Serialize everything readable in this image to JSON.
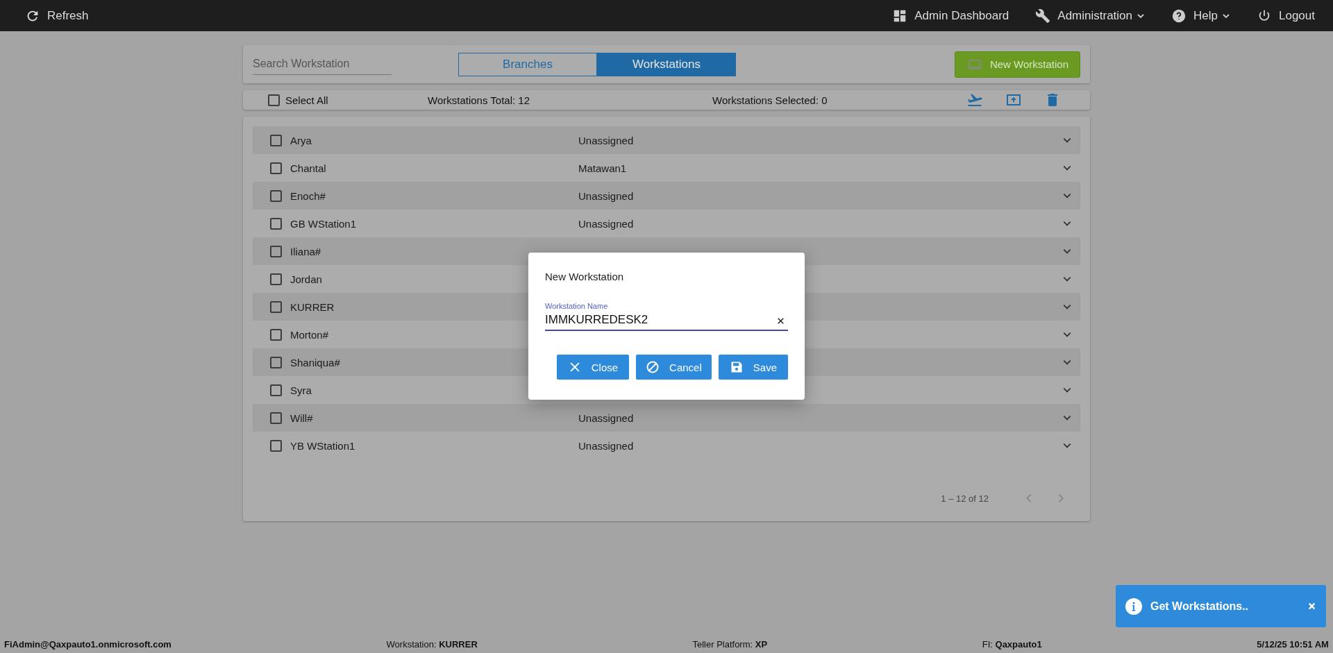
{
  "topbar": {
    "refresh": "Refresh",
    "links": [
      {
        "kind": "dashboard",
        "label": "Admin Dashboard",
        "dropdown": false
      },
      {
        "kind": "wrench",
        "label": "Administration",
        "dropdown": true
      },
      {
        "kind": "help",
        "label": "Help",
        "dropdown": true
      },
      {
        "kind": "power",
        "label": "Logout",
        "dropdown": false
      }
    ]
  },
  "search": {
    "placeholder": "Search Workstation"
  },
  "tabs": [
    {
      "label": "Branches",
      "selected": false
    },
    {
      "label": "Workstations",
      "selected": true
    }
  ],
  "new_button": "New Workstation",
  "toolbar": {
    "select_all": {
      "label": "Select All",
      "checked": false
    },
    "total": "Workstations Total: 12",
    "selected": "Workstations Selected: 0",
    "actions": [
      {
        "kind": "move"
      },
      {
        "kind": "upload"
      },
      {
        "kind": "delete"
      }
    ]
  },
  "rows": [
    {
      "name": "Arya",
      "location": "Unassigned",
      "checked": false
    },
    {
      "name": "Chantal",
      "location": "Matawan1",
      "checked": false
    },
    {
      "name": "Enoch#",
      "location": "Unassigned",
      "checked": false
    },
    {
      "name": "GB WStation1",
      "location": "Unassigned",
      "checked": false
    },
    {
      "name": "Iliana#",
      "checked": false
    },
    {
      "name": "Jordan",
      "checked": false
    },
    {
      "name": "KURRER",
      "checked": false
    },
    {
      "name": "Morton#",
      "checked": false
    },
    {
      "name": "Shaniqua#",
      "checked": false
    },
    {
      "name": "Syra",
      "checked": false
    },
    {
      "name": "Will#",
      "location": "Unassigned",
      "checked": false
    },
    {
      "name": "YB WStation1",
      "location": "Unassigned",
      "checked": false
    }
  ],
  "pagination": {
    "range": "1 – 12 of 12"
  },
  "dialog": {
    "title": "New Workstation",
    "field": {
      "label": "Workstation Name",
      "value": "IMMKURREDESK2"
    },
    "buttons": [
      {
        "kind": "close",
        "label": "Close"
      },
      {
        "kind": "cancel",
        "label": "Cancel"
      },
      {
        "kind": "save",
        "label": "Save"
      }
    ]
  },
  "status_bar": [
    {
      "value": "FiAdmin@Qaxpauto1.onmicrosoft.com"
    },
    {
      "label": "Workstation: ",
      "value": "KURRER"
    },
    {
      "label": "Teller Platform: ",
      "value": "XP"
    },
    {
      "label": "FI: ",
      "value": "Qaxpauto1"
    },
    {
      "value": "5/12/25 10:51 AM"
    }
  ],
  "toast": {
    "message": "Get Workstations.."
  }
}
